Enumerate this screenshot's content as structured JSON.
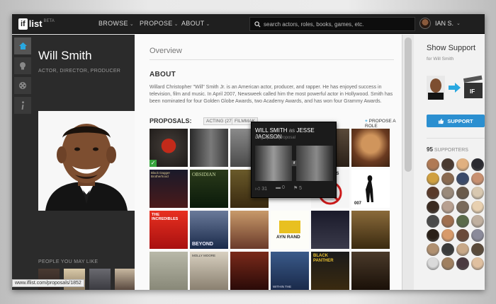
{
  "topbar": {
    "logo_box": "if",
    "logo_text": "list",
    "logo_beta": "BETA",
    "nav": [
      {
        "label": "BROWSE"
      },
      {
        "label": "PROPOSE"
      },
      {
        "label": "ABOUT"
      }
    ],
    "search_placeholder": "search actors, roles, books, games, etc.",
    "user_name": "IAN S."
  },
  "profile": {
    "name": "Will Smith",
    "roles": "ACTOR, DIRECTOR, PRODUCER",
    "people_you_may_like": "PEOPLE YOU MAY LIKE"
  },
  "main": {
    "overview_heading": "Overview",
    "about_heading": "ABOUT",
    "about_text": "Willard Christopher \"Will\" Smith Jr. is an American actor, producer, and rapper. He has enjoyed success in television, film and music. In April 2007, Newsweek called him the most powerful actor in Hollywood. Smith has been nominated for four Golden Globe Awards, two Academy Awards, and has won four Grammy Awards.",
    "proposals_label": "PROPOSALS:",
    "tabs": [
      {
        "label": "ACTING (27)"
      },
      {
        "label": "FILMMAK"
      }
    ],
    "propose_role_label": "PROPOSE A ROLE",
    "grid_texts": {
      "ghostbusters": "STBUSTERS",
      "incredibles": "THE INCREDIBLES",
      "beyond": "BEYOND",
      "aynrand": "AYN RAND",
      "obsidian": "OBSIDIAN",
      "bbhood": "Black Dagger Brotherhood",
      "bond": "007",
      "panther": "BLACK PANTHER",
      "molly": "MOLLY MOORE",
      "within": "WITHIN THE"
    }
  },
  "popup": {
    "actor": "WILL SMITH",
    "as": "as",
    "role": "JESSE JACKSON",
    "subtitle": "biographical proposal",
    "likes": "31",
    "comments": "0",
    "shares": "5"
  },
  "sidebar": {
    "heading": "Show Support",
    "sub": "for Will Smith",
    "button_label": "SUPPORT",
    "supporters_count": "95",
    "supporters_label": "SUPPORTERS"
  },
  "statusbar": {
    "url": "www.iflist.com/proposals/1852"
  },
  "colors": {
    "accent_blue": "#2b8fd0",
    "topbar": "#1f1f1f",
    "leftcol": "#2b2b2b",
    "check_green": "#37a33d"
  }
}
